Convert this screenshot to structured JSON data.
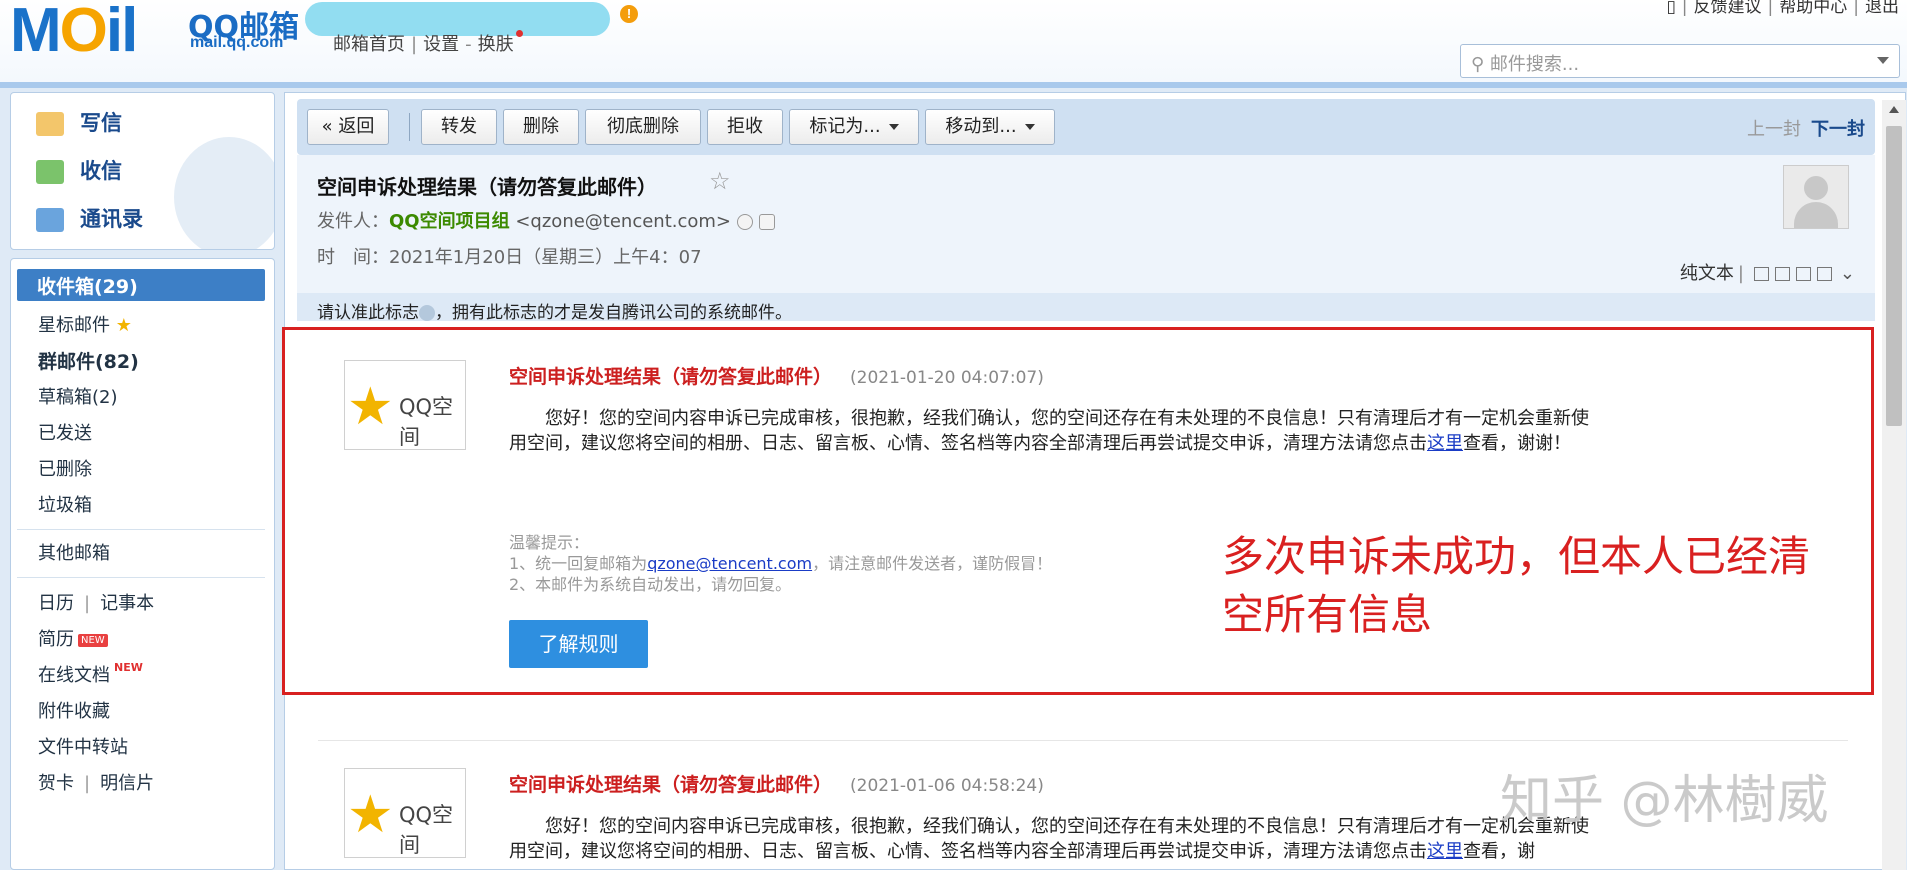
{
  "header": {
    "logo_mail": "M",
    "logo_mail_o": "O",
    "logo_mail_rest": "il",
    "logo_qq": "QQ邮箱",
    "logo_url": "mail.qq.com",
    "top_links": [
      "邮箱首页",
      "设置",
      "换肤"
    ],
    "right_links": [
      "反馈建议",
      "帮助中心",
      "退出"
    ],
    "search_placeholder": "邮件搜索..."
  },
  "quick": {
    "write": "写信",
    "receive": "收信",
    "contacts": "通讯录"
  },
  "folders": {
    "inbox": "收件箱(29)",
    "starred": "星标邮件",
    "group": "群邮件(82)",
    "drafts": "草稿箱(2)",
    "sent": "已发送",
    "deleted": "已删除",
    "spam": "垃圾箱",
    "other": "其他邮箱",
    "calendar": "日历",
    "notes": "记事本",
    "resume": "简历",
    "docs": "在线文档",
    "attachments": "附件收藏",
    "transfer": "文件中转站",
    "cards": "贺卡",
    "postcards": "明信片",
    "new_tag": "NEW"
  },
  "toolbar": {
    "back": "« 返回",
    "forward": "转发",
    "delete": "删除",
    "delete_perm": "彻底删除",
    "reject": "拒收",
    "mark_as": "标记为...",
    "move_to": "移动到...",
    "prev": "上一封",
    "next": "下一封"
  },
  "mail": {
    "subject": "空间申诉处理结果（请勿答复此邮件）",
    "from_label": "发件人：",
    "from_name": "QQ空间项目组",
    "from_email": "<qzone@tencent.com>",
    "time_label": "时　间：",
    "time_value": "2021年1月20日（星期三）上午4：07",
    "plain_text": "纯文本",
    "verify_text_a": "请认准此标志",
    "verify_text_b": "，拥有此标志的才是发自腾讯公司的系统邮件。"
  },
  "cards": [
    {
      "logo": "QQ空间",
      "title": "空间申诉处理结果（请勿答复此邮件）",
      "time": "(2021-01-20 04:07:07)",
      "body_a": "您好！您的空间内容申诉已完成审核，很抱歉，经我们确认，您的空间还存在有未处理的不良信息！只有清理后才有一定机会重新使用空间，建议您将空间的相册、日志、留言板、心情、签名档等内容全部清理后再尝试提交申诉，清理方法请您点击",
      "link": "这里",
      "body_b": "查看，谢谢！",
      "tips_title": "温馨提示：",
      "tip1_a": "1、统一回复邮箱为",
      "tip1_link": "qzone@tencent.com",
      "tip1_b": "，请注意邮件发送者，谨防假冒！",
      "tip2": "2、本邮件为系统自动发出，请勿回复。",
      "button": "了解规则"
    },
    {
      "logo": "QQ空间",
      "title": "空间申诉处理结果（请勿答复此邮件）",
      "time": "(2021-01-06 04:58:24)",
      "body_a": "您好！您的空间内容申诉已完成审核，很抱歉，经我们确认，您的空间还存在有未处理的不良信息！只有清理后才有一定机会重新使用空间，建议您将空间的相册、日志、留言板、心情、签名档等内容全部清理后再尝试提交申诉，清理方法请您点击",
      "link": "这里",
      "body_b": "查看，谢"
    }
  ],
  "annotation": "多次申诉未成功，但本人已经清空所有信息",
  "watermark": "知乎 @林樹威",
  "colors": {
    "brand_blue": "#1a72c9",
    "inbox_active": "#3d7fc6",
    "annotation_red": "#d82020",
    "sender_green": "#3c8a00"
  }
}
